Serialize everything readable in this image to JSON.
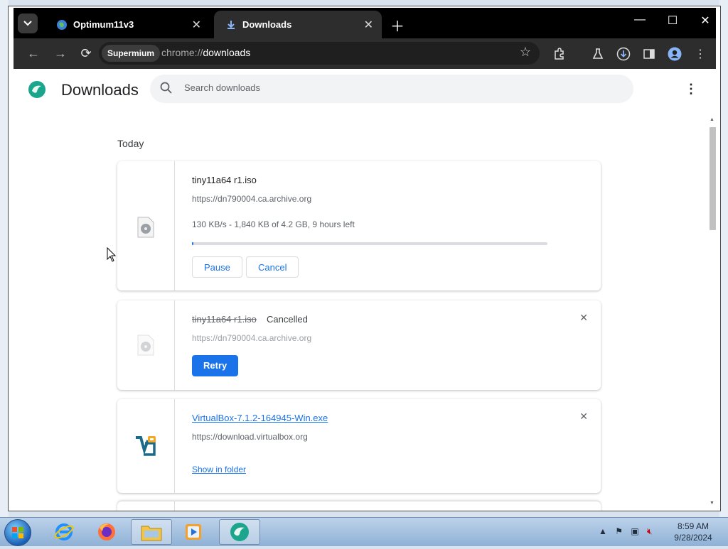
{
  "browser": {
    "tabs": [
      {
        "title": "Optimum11v3",
        "active": false
      },
      {
        "title": "Downloads",
        "active": true
      }
    ],
    "omnibox": {
      "chip": "Supermium",
      "scheme": "chrome://",
      "path": "downloads"
    }
  },
  "page": {
    "title": "Downloads",
    "search_placeholder": "Search downloads",
    "section": "Today",
    "downloads": [
      {
        "filename": "tiny11a64 r1.iso",
        "source": "https://dn790004.ca.archive.org",
        "progress_text": "130 KB/s - 1,840 KB of 4.2 GB, 9 hours left",
        "progress": 0.0004,
        "actions": [
          "Pause",
          "Cancel"
        ]
      },
      {
        "filename": "tiny11a64 r1.iso",
        "status": "Cancelled",
        "source": "https://dn790004.ca.archive.org",
        "actions": [
          "Retry"
        ]
      },
      {
        "filename": "VirtualBox-7.1.2-164945-Win.exe",
        "source": "https://download.virtualbox.org",
        "actions": [
          "Show in folder"
        ]
      }
    ]
  },
  "taskbar": {
    "time": "8:59 AM",
    "date": "9/28/2024"
  },
  "colors": {
    "accent": "#1a73e8",
    "toolbar": "#2d2d2d",
    "tabstrip": "#000000"
  }
}
